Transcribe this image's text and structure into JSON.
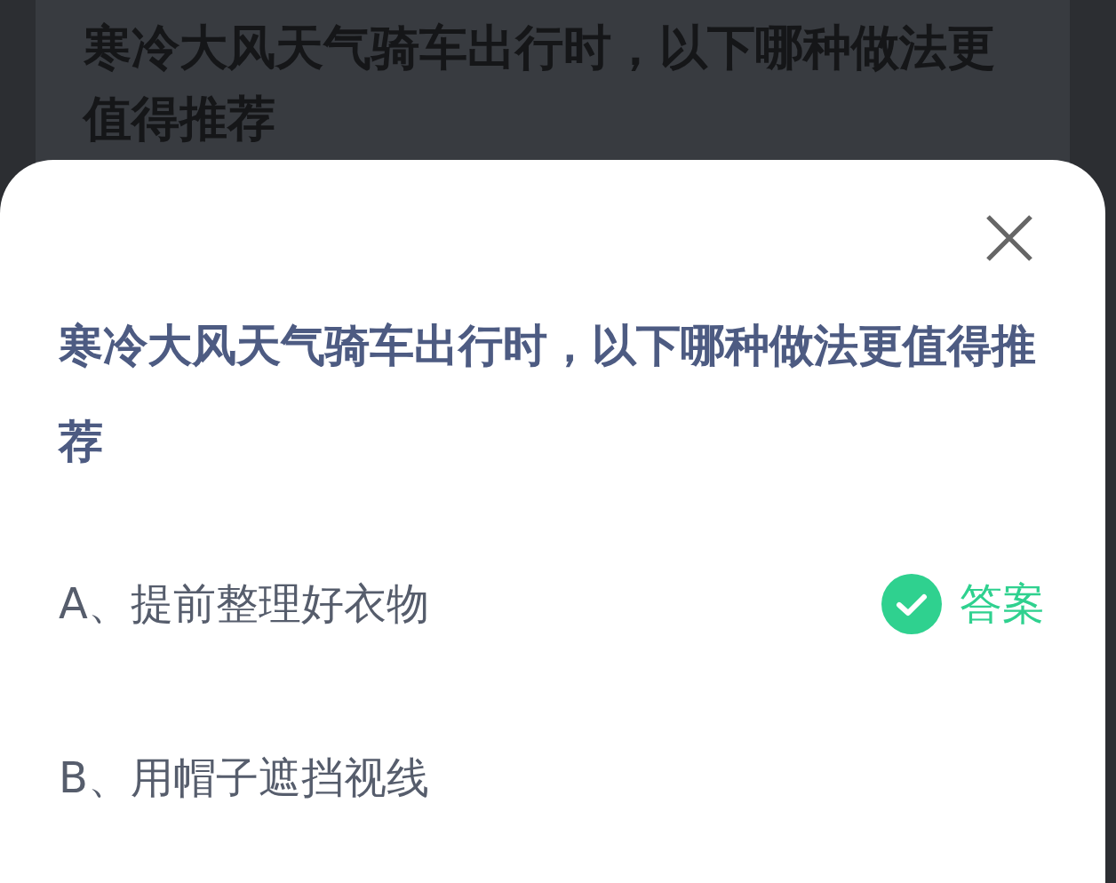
{
  "background_card": {
    "question": "寒冷大风天气骑车出行时，以下哪种做法更值得推荐"
  },
  "sheet": {
    "question": "寒冷大风天气骑车出行时，以下哪种做法更值得推荐",
    "answer_label": "答案",
    "options": [
      {
        "label": "A、提前整理好衣物",
        "correct": true
      },
      {
        "label": "B、用帽子遮挡视线",
        "correct": false
      }
    ]
  }
}
